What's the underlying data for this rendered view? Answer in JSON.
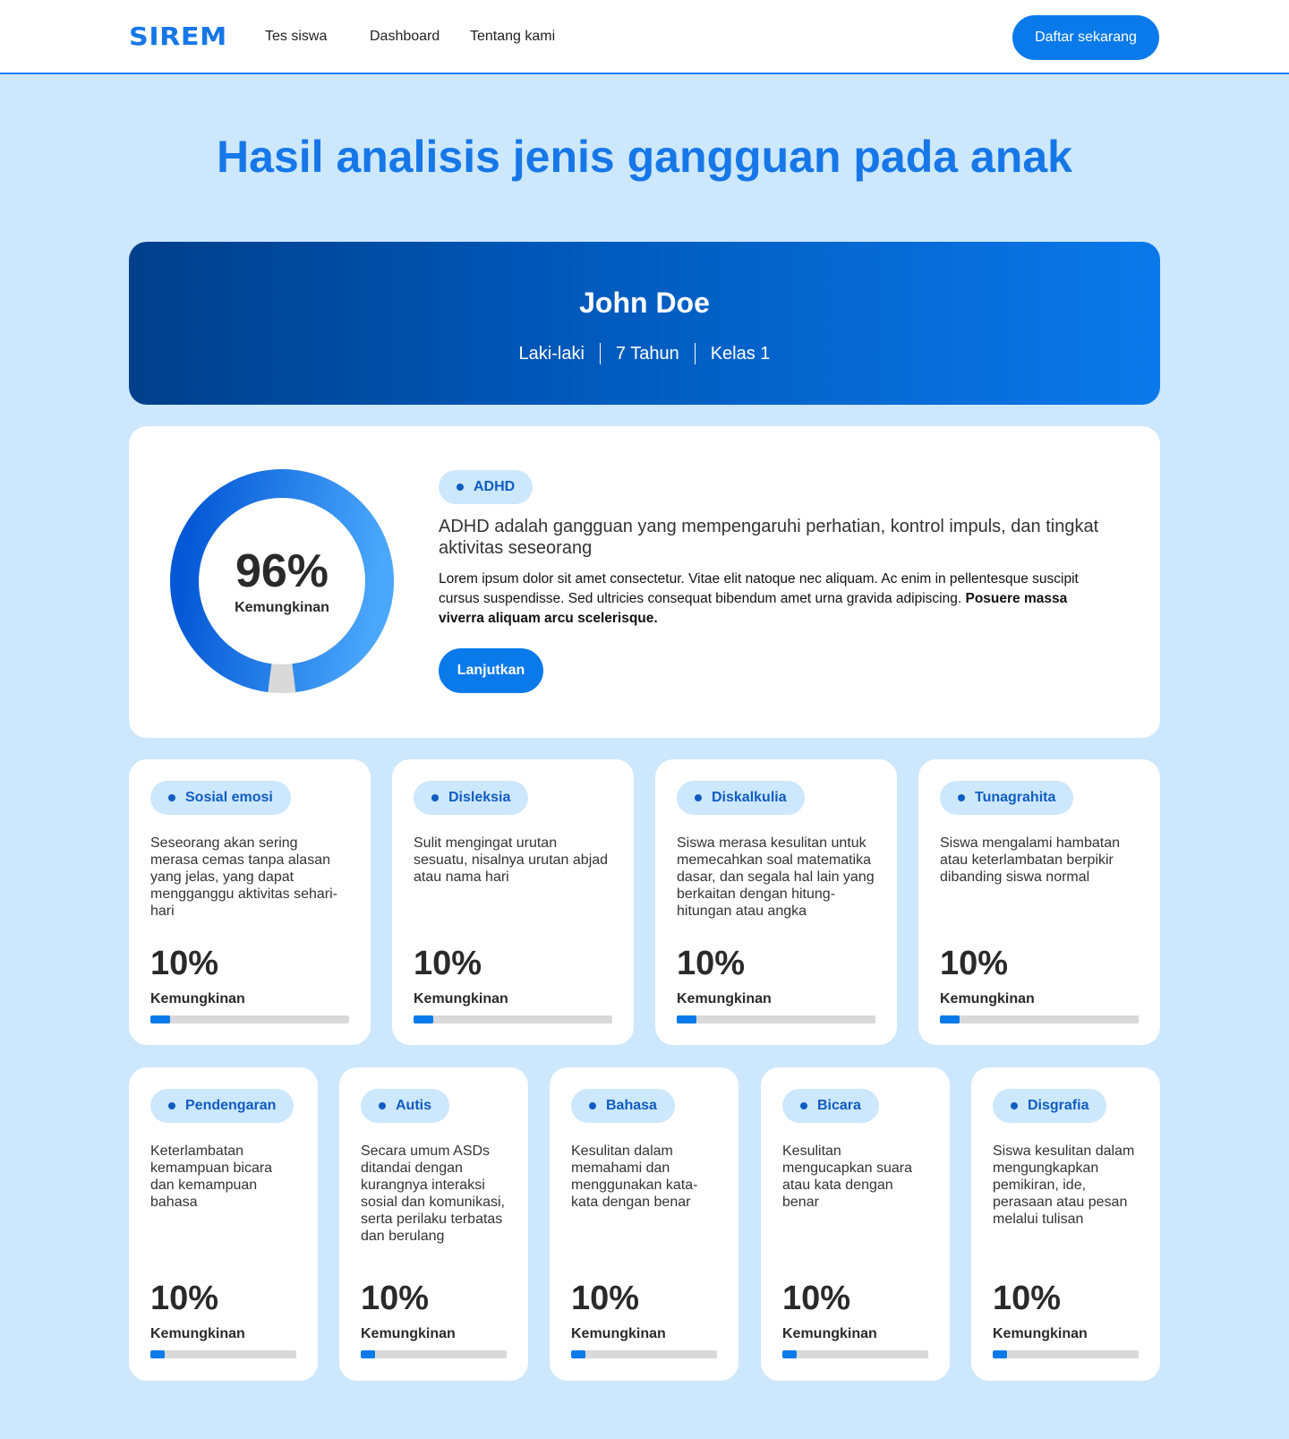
{
  "nav": {
    "logo": "SIREM",
    "links": [
      "Tes siswa",
      "Dashboard",
      "Tentang kami"
    ],
    "cta": "Daftar sekarang"
  },
  "page_title": "Hasil analisis jenis gangguan pada anak",
  "profile": {
    "name": "John Doe",
    "gender": "Laki-laki",
    "age": "7 Tahun",
    "grade": "Kelas 1"
  },
  "main_result": {
    "tag": "ADHD",
    "percent_text": "96%",
    "percent_value": 96,
    "label": "Kemungkinan",
    "description": "ADHD adalah gangguan yang mempengaruhi perhatian, kontrol impuls, dan tingkat aktivitas seseorang",
    "body": "Lorem ipsum dolor sit amet consectetur. Vitae elit natoque nec aliquam. Ac enim in pellentesque suscipit cursus suspendisse. Sed ultricies consequat bibendum amet urna gravida adipiscing.",
    "body_bold": "Posuere massa viverra aliquam arcu scelerisque.",
    "button": "Lanjutkan"
  },
  "row1": [
    {
      "tag": "Sosial emosi",
      "desc": "Seseorang akan sering merasa cemas tanpa alasan yang jelas, yang dapat mengganggu aktivitas sehari-hari",
      "percent_text": "10%",
      "percent_value": 10,
      "label": "Kemungkinan"
    },
    {
      "tag": "Disleksia",
      "desc": "Sulit mengingat urutan sesuatu, nisalnya urutan abjad atau nama hari",
      "percent_text": "10%",
      "percent_value": 10,
      "label": "Kemungkinan"
    },
    {
      "tag": "Diskalkulia",
      "desc": "Siswa merasa kesulitan untuk memecahkan soal matematika dasar, dan segala hal lain yang berkaitan dengan hitung-hitungan atau angka",
      "percent_text": "10%",
      "percent_value": 10,
      "label": "Kemungkinan"
    },
    {
      "tag": "Tunagrahita",
      "desc": "Siswa mengalami hambatan atau keterlambatan berpikir dibanding siswa normal",
      "percent_text": "10%",
      "percent_value": 10,
      "label": "Kemungkinan"
    }
  ],
  "row2": [
    {
      "tag": "Pendengaran",
      "desc": "Keterlambatan kemampuan bicara dan kemampuan bahasa",
      "percent_text": "10%",
      "percent_value": 10,
      "label": "Kemungkinan"
    },
    {
      "tag": "Autis",
      "desc": "Secara umum ASDs ditandai dengan kurangnya interaksi sosial dan komunikasi, serta perilaku terbatas dan berulang",
      "percent_text": "10%",
      "percent_value": 10,
      "label": "Kemungkinan"
    },
    {
      "tag": "Bahasa",
      "desc": "Kesulitan dalam memahami dan menggunakan kata-kata dengan benar",
      "percent_text": "10%",
      "percent_value": 10,
      "label": "Kemungkinan"
    },
    {
      "tag": "Bicara",
      "desc": "Kesulitan mengucapkan suara atau kata dengan benar",
      "percent_text": "10%",
      "percent_value": 10,
      "label": "Kemungkinan"
    },
    {
      "tag": "Disgrafia",
      "desc": "Siswa kesulitan dalam mengungkapkan pemikiran, ide, perasaan atau pesan melalui tulisan",
      "percent_text": "10%",
      "percent_value": 10,
      "label": "Kemungkinan"
    }
  ],
  "colors": {
    "accent": "#0a7aeb",
    "brand": "#1677e8",
    "background": "#cde7fc",
    "tag_bg": "#cde7fc",
    "tag_text": "#0f5cc2",
    "bar_track": "#d9d9d9"
  }
}
